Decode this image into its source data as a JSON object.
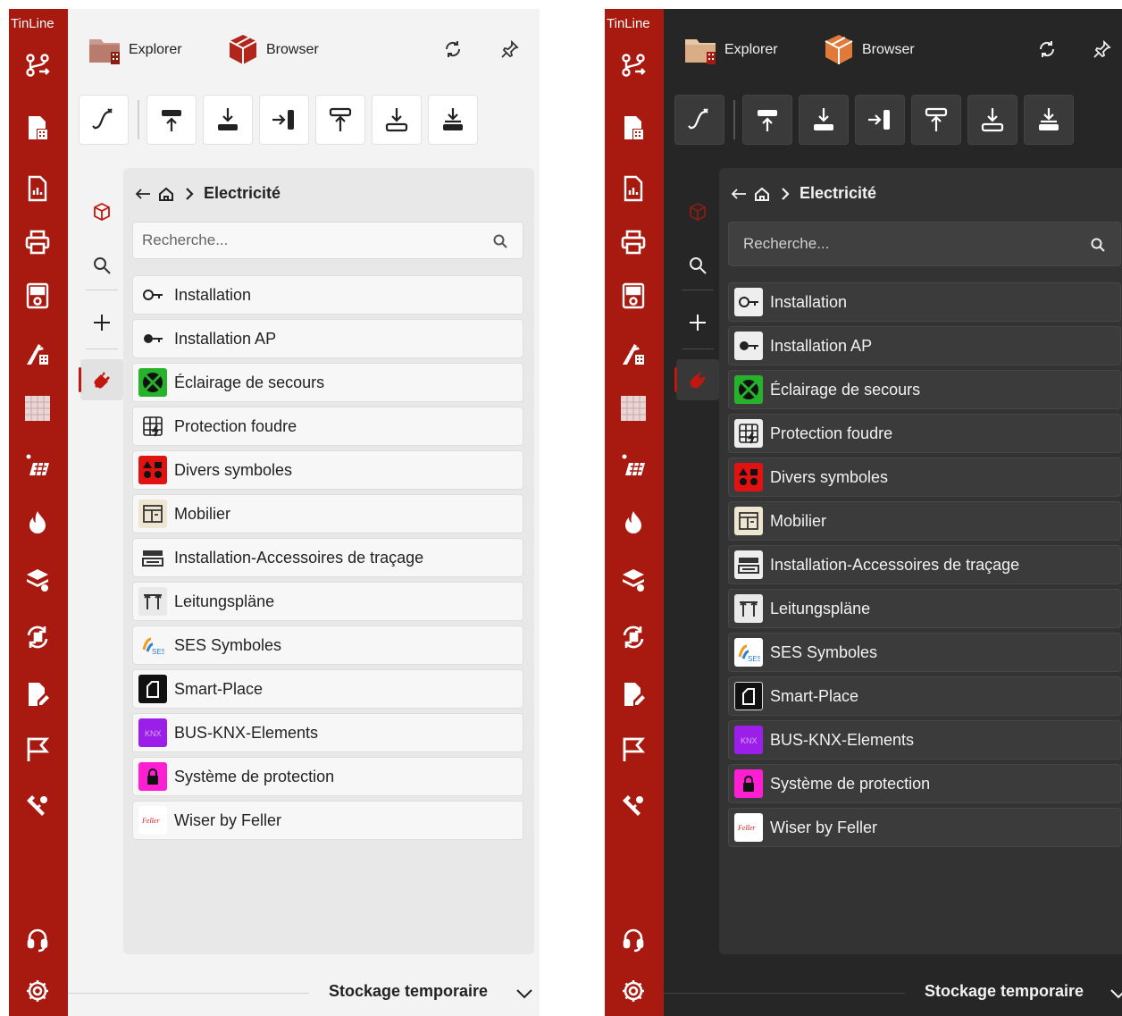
{
  "app": {
    "brand": "TinLine"
  },
  "topbar": {
    "explorer_label": "Explorer",
    "browser_label": "Browser"
  },
  "breadcrumb": {
    "current": "Electricité"
  },
  "search": {
    "placeholder": "Recherche..."
  },
  "items": [
    {
      "label": "Installation",
      "icon": "key-outline-icon"
    },
    {
      "label": "Installation AP",
      "icon": "key-filled-icon"
    },
    {
      "label": "Éclairage de secours",
      "icon": "emergency-light-icon"
    },
    {
      "label": "Protection foudre",
      "icon": "lightning-grid-icon"
    },
    {
      "label": "Divers symboles",
      "icon": "shapes-icon"
    },
    {
      "label": "Mobilier",
      "icon": "furniture-icon"
    },
    {
      "label": "Installation-Accessoires de traçage",
      "icon": "cable-duct-icon"
    },
    {
      "label": "Leitungspläne",
      "icon": "line-plan-icon"
    },
    {
      "label": "SES Symboles",
      "icon": "ses-logo-icon"
    },
    {
      "label": "Smart-Place",
      "icon": "smart-place-icon"
    },
    {
      "label": "BUS-KNX-Elements",
      "icon": "knx-logo-icon"
    },
    {
      "label": "Système de protection",
      "icon": "lock-icon"
    },
    {
      "label": "Wiser by Feller",
      "icon": "feller-logo-icon"
    }
  ],
  "footer": {
    "label": "Stockage temporaire"
  },
  "colors": {
    "rail": "#a8190f",
    "accent": "#c0180f"
  }
}
